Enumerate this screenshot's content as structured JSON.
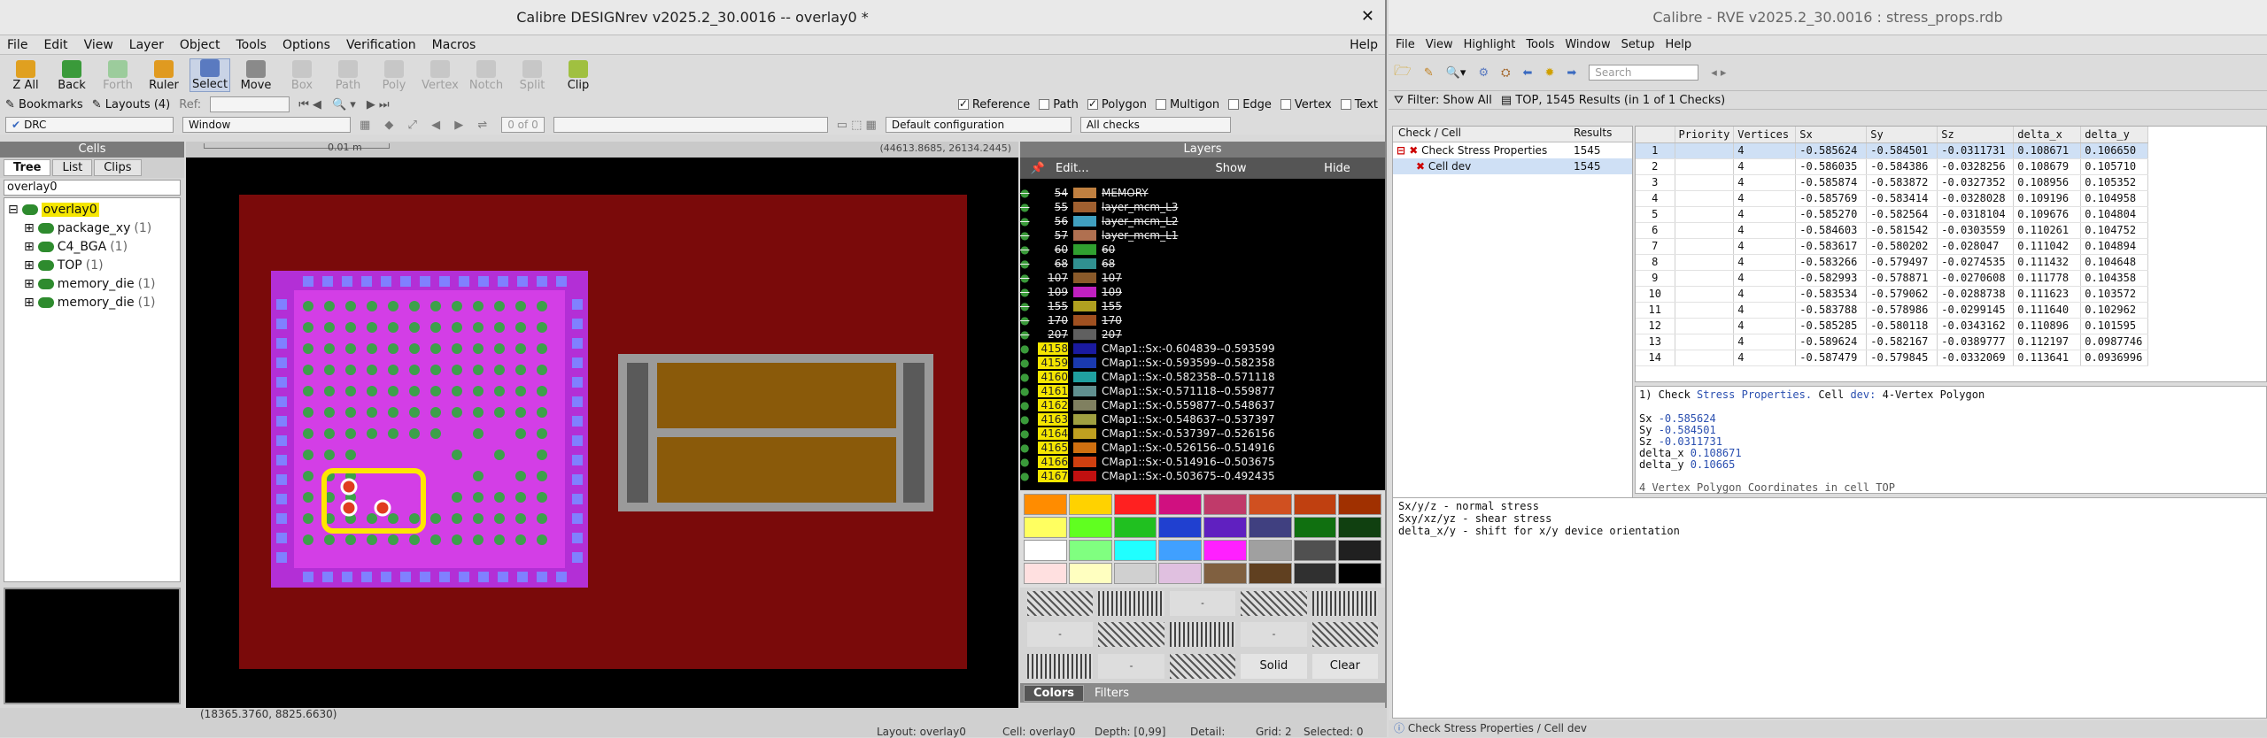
{
  "designrev": {
    "title": "Calibre DESIGNrev v2025.2_30.0016  --  overlay0 *",
    "menus": [
      "File",
      "Edit",
      "View",
      "Layer",
      "Object",
      "Tools",
      "Options",
      "Verification",
      "Macros"
    ],
    "help": "Help",
    "tools": [
      {
        "label": "Z All",
        "enabled": true,
        "color": "#e0a020"
      },
      {
        "label": "Back",
        "enabled": true,
        "color": "#3a9a3a"
      },
      {
        "label": "Forth",
        "enabled": false,
        "color": "#9ccc9c"
      },
      {
        "label": "Ruler",
        "enabled": true,
        "color": "#e09a20"
      },
      {
        "label": "Select",
        "enabled": true,
        "color": "#5a7ac0"
      },
      {
        "label": "Move",
        "enabled": true,
        "color": "#8a8a8a"
      },
      {
        "label": "Box",
        "enabled": false,
        "color": "#c7c7c7"
      },
      {
        "label": "Path",
        "enabled": false,
        "color": "#c7c7c7"
      },
      {
        "label": "Poly",
        "enabled": false,
        "color": "#c7c7c7"
      },
      {
        "label": "Vertex",
        "enabled": false,
        "color": "#c7c7c7"
      },
      {
        "label": "Notch",
        "enabled": false,
        "color": "#c7c7c7"
      },
      {
        "label": "Split",
        "enabled": false,
        "color": "#c7c7c7"
      },
      {
        "label": "Clip",
        "enabled": true,
        "color": "#a0c040"
      }
    ],
    "bookmarks": "Bookmarks",
    "layouts": "Layouts (4)",
    "ref_label": "Ref:",
    "filters": [
      {
        "label": "Reference",
        "checked": true
      },
      {
        "label": "Path",
        "checked": false
      },
      {
        "label": "Polygon",
        "checked": true
      },
      {
        "label": "Multigon",
        "checked": false
      },
      {
        "label": "Edge",
        "checked": false
      },
      {
        "label": "Vertex",
        "checked": false
      },
      {
        "label": "Text",
        "checked": false
      }
    ],
    "drc_combo": "DRC",
    "window_combo": "Window",
    "page_of": "0 of 0",
    "config_combo": "Default configuration",
    "checks_combo": "All checks",
    "cells_header": "Cells",
    "cell_tabs": [
      "Tree",
      "List",
      "Clips"
    ],
    "cell_search": "overlay0",
    "cells": [
      {
        "name": "overlay0",
        "count": "",
        "highlight": true,
        "indent": 0
      },
      {
        "name": "package_xy",
        "count": "(1)",
        "highlight": false,
        "indent": 1
      },
      {
        "name": "C4_BGA",
        "count": "(1)",
        "highlight": false,
        "indent": 1
      },
      {
        "name": "TOP",
        "count": "(1)",
        "highlight": false,
        "indent": 1
      },
      {
        "name": "memory_die",
        "count": "(1)",
        "highlight": false,
        "indent": 1
      },
      {
        "name": "memory_die",
        "count": "(1)",
        "highlight": false,
        "indent": 1
      }
    ],
    "canvas_scale": "0.01 m",
    "canvas_coords": "(44613.8685, 26134.2445)",
    "layers_header": "Layers",
    "layer_buttons": [
      "Edit...",
      "Show",
      "Hide"
    ],
    "layers": [
      {
        "num": "54",
        "name": "MEMORY",
        "color": "#c08040"
      },
      {
        "num": "55",
        "name": "layer_mcm_L3",
        "color": "#a06030"
      },
      {
        "num": "56",
        "name": "layer_mcm_L2",
        "color": "#40a0c0"
      },
      {
        "num": "57",
        "name": "layer_mcm_L1",
        "color": "#b07050"
      },
      {
        "num": "60",
        "name": "60",
        "color": "#30a030"
      },
      {
        "num": "68",
        "name": "68",
        "color": "#309090"
      },
      {
        "num": "107",
        "name": "107",
        "color": "#8a5a2a"
      },
      {
        "num": "109",
        "name": "109",
        "color": "#c020c0"
      },
      {
        "num": "155",
        "name": "155",
        "color": "#b0a020"
      },
      {
        "num": "170",
        "name": "170",
        "color": "#a05020"
      },
      {
        "num": "207",
        "name": "207",
        "color": "#606060"
      },
      {
        "num": "4158",
        "name": "CMap1::Sx:-0.604839--0.593599",
        "color": "#1a1aa0"
      },
      {
        "num": "4159",
        "name": "CMap1::Sx:-0.593599--0.582358",
        "color": "#1a3ab0"
      },
      {
        "num": "4160",
        "name": "CMap1::Sx:-0.582358--0.571118",
        "color": "#20a0a0"
      },
      {
        "num": "4161",
        "name": "CMap1::Sx:-0.571118--0.559877",
        "color": "#609090"
      },
      {
        "num": "4162",
        "name": "CMap1::Sx:-0.559877--0.548637",
        "color": "#808060"
      },
      {
        "num": "4163",
        "name": "CMap1::Sx:-0.548637--0.537397",
        "color": "#a0a040"
      },
      {
        "num": "4164",
        "name": "CMap1::Sx:-0.537397--0.526156",
        "color": "#c0a020"
      },
      {
        "num": "4165",
        "name": "CMap1::Sx:-0.526156--0.514916",
        "color": "#d07010"
      },
      {
        "num": "4166",
        "name": "CMap1::Sx:-0.514916--0.503675",
        "color": "#d04010"
      },
      {
        "num": "4167",
        "name": "CMap1::Sx:-0.503675--0.492435",
        "color": "#c01010"
      }
    ],
    "palette_buttons": [
      "Solid",
      "Clear"
    ],
    "bottom_tabs": [
      "Colors",
      "Filters"
    ],
    "cursor_coords": "(18365.3760, 8825.6630)",
    "status": {
      "layout": "Layout: overlay0",
      "cell": "Cell: overlay0",
      "depth": "Depth: [0,99]",
      "detail": "Detail:",
      "grid": "Grid: 2",
      "selected": "Selected: 0"
    }
  },
  "rve": {
    "title": "Calibre - RVE v2025.2_30.0016 : stress_props.rdb",
    "menus": [
      "File",
      "View",
      "Highlight",
      "Tools",
      "Window",
      "Setup",
      "Help"
    ],
    "search_placeholder": "Search",
    "filter": "Filter: Show All",
    "summary": "TOP, 1545 Results (in 1 of 1 Checks)",
    "tree_headers": [
      "Check / Cell",
      "Results"
    ],
    "tree_rows": [
      {
        "label": "Check Stress Properties",
        "results": "1545"
      },
      {
        "label": "Cell dev",
        "results": "1545"
      }
    ],
    "result_headers": [
      "",
      "Priority",
      "Vertices",
      "Sx",
      "Sy",
      "Sz",
      "delta_x",
      "delta_y"
    ],
    "results": [
      [
        "1",
        "",
        "4",
        "-0.585624",
        "-0.584501",
        "-0.0311731",
        "0.108671",
        "0.106650"
      ],
      [
        "2",
        "",
        "4",
        "-0.586035",
        "-0.584386",
        "-0.0328256",
        "0.108679",
        "0.105710"
      ],
      [
        "3",
        "",
        "4",
        "-0.585874",
        "-0.583872",
        "-0.0327352",
        "0.108956",
        "0.105352"
      ],
      [
        "4",
        "",
        "4",
        "-0.585769",
        "-0.583414",
        "-0.0328028",
        "0.109196",
        "0.104958"
      ],
      [
        "5",
        "",
        "4",
        "-0.585270",
        "-0.582564",
        "-0.0318104",
        "0.109676",
        "0.104804"
      ],
      [
        "6",
        "",
        "4",
        "-0.584603",
        "-0.581542",
        "-0.0303559",
        "0.110261",
        "0.104752"
      ],
      [
        "7",
        "",
        "4",
        "-0.583617",
        "-0.580202",
        "-0.028047",
        "0.111042",
        "0.104894"
      ],
      [
        "8",
        "",
        "4",
        "-0.583266",
        "-0.579497",
        "-0.0274535",
        "0.111432",
        "0.104648"
      ],
      [
        "9",
        "",
        "4",
        "-0.582993",
        "-0.578871",
        "-0.0270608",
        "0.111778",
        "0.104358"
      ],
      [
        "10",
        "",
        "4",
        "-0.583534",
        "-0.579062",
        "-0.0288738",
        "0.111623",
        "0.103572"
      ],
      [
        "11",
        "",
        "4",
        "-0.583788",
        "-0.578986",
        "-0.0299145",
        "0.111640",
        "0.102962"
      ],
      [
        "12",
        "",
        "4",
        "-0.585285",
        "-0.580118",
        "-0.0343162",
        "0.110896",
        "0.101595"
      ],
      [
        "13",
        "",
        "4",
        "-0.589624",
        "-0.582167",
        "-0.0389777",
        "0.112197",
        "0.0987746"
      ],
      [
        "14",
        "",
        "4",
        "-0.587479",
        "-0.579845",
        "-0.0332069",
        "0.113641",
        "0.0936996"
      ]
    ],
    "detail_title_prefix": "1) Check",
    "detail_title_check": "Stress Properties.",
    "detail_title_cell_label": "Cell",
    "detail_title_cell": "dev:",
    "detail_title_suffix": "4-Vertex Polygon",
    "detail_values": [
      {
        "key": "Sx",
        "val": "-0.585624"
      },
      {
        "key": "Sy",
        "val": "-0.584501"
      },
      {
        "key": "Sz",
        "val": "-0.0311731"
      },
      {
        "key": "delta_x",
        "val": "0.108671"
      },
      {
        "key": "delta_y",
        "val": "0.10665"
      }
    ],
    "detail_trailer": "4 Vertex Polygon  Coordinates in cell TOP",
    "legend": [
      "Sx/y/z - normal stress",
      "Sxy/xz/yz - shear stress",
      "delta_x/y - shift for x/y device orientation"
    ],
    "status": "Check Stress Properties / Cell dev"
  }
}
